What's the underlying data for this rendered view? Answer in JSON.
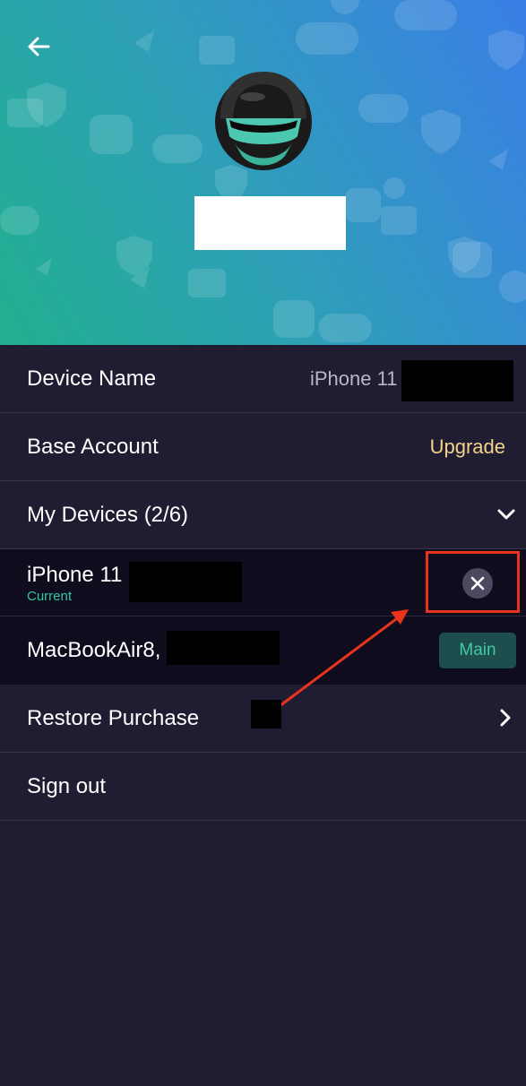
{
  "header": {
    "back_icon": "arrow-left-icon",
    "avatar": "helmet-avatar",
    "background_colors": [
      "#21b08f",
      "#3a7ee6"
    ]
  },
  "settings": {
    "device_name": {
      "label": "Device Name",
      "value": "iPhone 11"
    },
    "account": {
      "label": "Base Account",
      "action": "Upgrade"
    },
    "my_devices": {
      "label": "My Devices (2/6)",
      "icon": "chevron-down-icon"
    },
    "devices": [
      {
        "name": "iPhone 11",
        "status": "Current",
        "action_icon": "close-icon"
      },
      {
        "name": "MacBookAir8,",
        "badge": "Main"
      }
    ],
    "restore": {
      "label": "Restore Purchase",
      "icon": "chevron-right-icon"
    },
    "sign_out": {
      "label": "Sign out"
    }
  },
  "annotation": {
    "color": "#e8341c"
  },
  "colors": {
    "background": "#201d32",
    "accent_green": "#2fc9a4",
    "upgrade_gold": "#f1d38c"
  }
}
